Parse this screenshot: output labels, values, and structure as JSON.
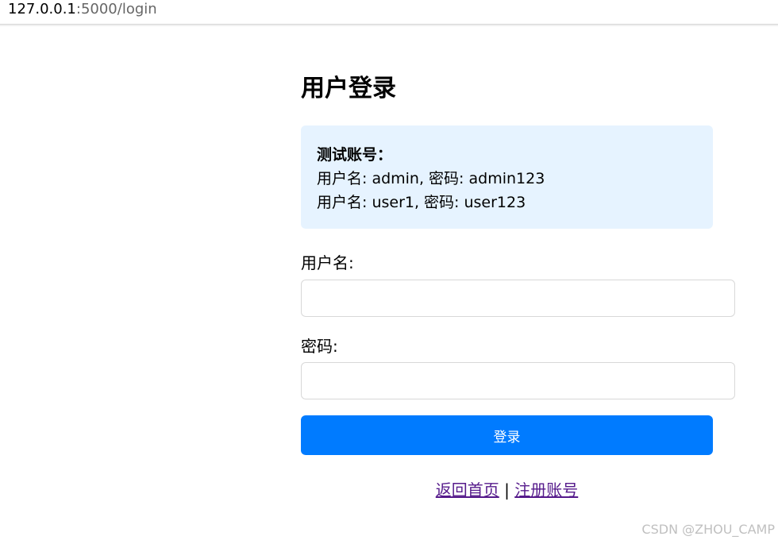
{
  "browser": {
    "url_host": "127.0.0.1",
    "url_rest": ":5000/login"
  },
  "page": {
    "title": "用户登录"
  },
  "info": {
    "title": "测试账号：",
    "accounts": [
      "用户名: admin, 密码: admin123",
      "用户名: user1, 密码: user123"
    ]
  },
  "form": {
    "username_label": "用户名:",
    "username_value": "",
    "password_label": "密码:",
    "password_value": "",
    "submit_label": "登录"
  },
  "links": {
    "home_label": "返回首页",
    "separator": "|",
    "register_label": "注册账号"
  },
  "watermark": {
    "text": "CSDN @ZHOU_CAMP"
  },
  "colors": {
    "primary_button": "#007bff",
    "info_background": "#e6f3ff",
    "visited_link": "#551a8b"
  }
}
